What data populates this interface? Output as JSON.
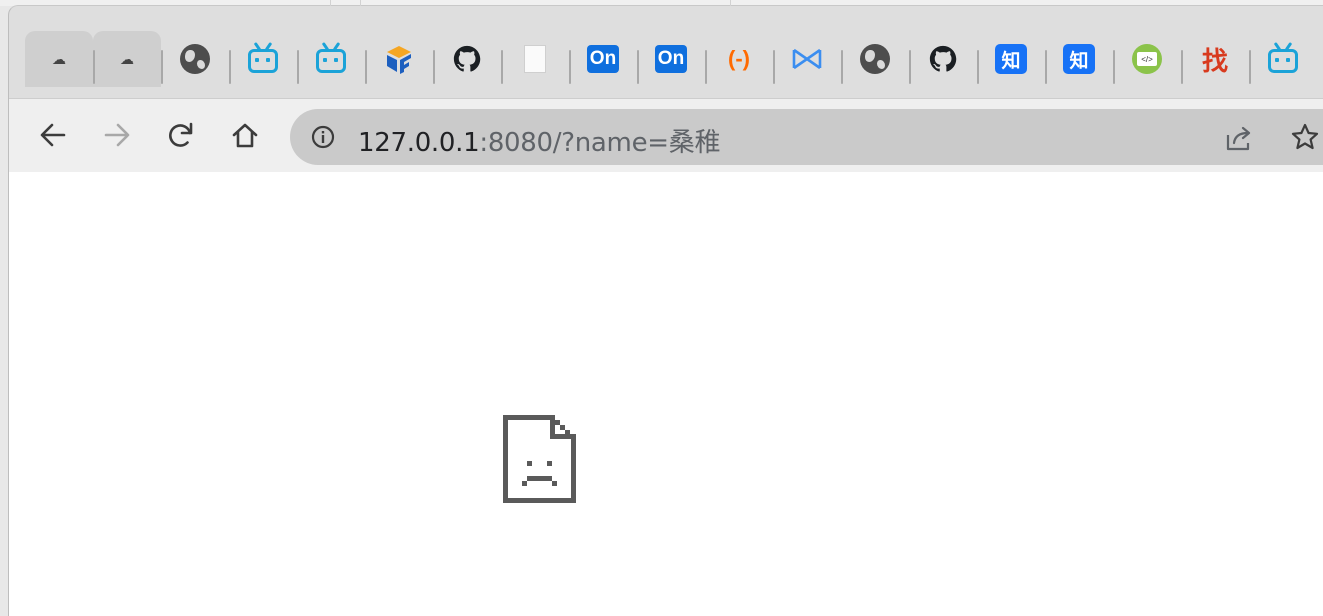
{
  "desktop": {
    "dividers": [
      330,
      360,
      730
    ]
  },
  "tabs": [
    {
      "icon": "cloud-favicon-icon",
      "glyph": "☁",
      "active": true
    },
    {
      "icon": "cloud-favicon-icon",
      "glyph": "☁",
      "active": true
    },
    {
      "icon": "globe-favicon-icon"
    },
    {
      "icon": "bilibili-favicon-icon"
    },
    {
      "icon": "bilibili-favicon-icon"
    },
    {
      "icon": "framework-favicon-icon"
    },
    {
      "icon": "github-favicon-icon"
    },
    {
      "icon": "blank-page-favicon-icon"
    },
    {
      "icon": "processon-favicon-icon",
      "text": "On"
    },
    {
      "icon": "processon-favicon-icon",
      "text": "On"
    },
    {
      "icon": "aliyun-favicon-icon",
      "text": "(-)"
    },
    {
      "icon": "bow-tie-favicon-icon"
    },
    {
      "icon": "globe-favicon-icon"
    },
    {
      "icon": "github-favicon-icon"
    },
    {
      "icon": "zhihu-favicon-icon",
      "text": "知"
    },
    {
      "icon": "zhihu-favicon-icon",
      "text": "知"
    },
    {
      "icon": "code-favicon-icon",
      "text": "</>"
    },
    {
      "icon": "zhao-favicon-icon",
      "text": "找"
    },
    {
      "icon": "bilibili-favicon-icon"
    }
  ],
  "toolbar": {
    "url_host": "127.0.0.1",
    "url_rest": ":8080/?name=桑稚"
  },
  "colors": {
    "tab_strip": "#dedede",
    "toolbar": "#efefef",
    "omnibox": "#cacaca",
    "icon_gray": "#5f6368",
    "error_icon": "#5a5a5a"
  }
}
